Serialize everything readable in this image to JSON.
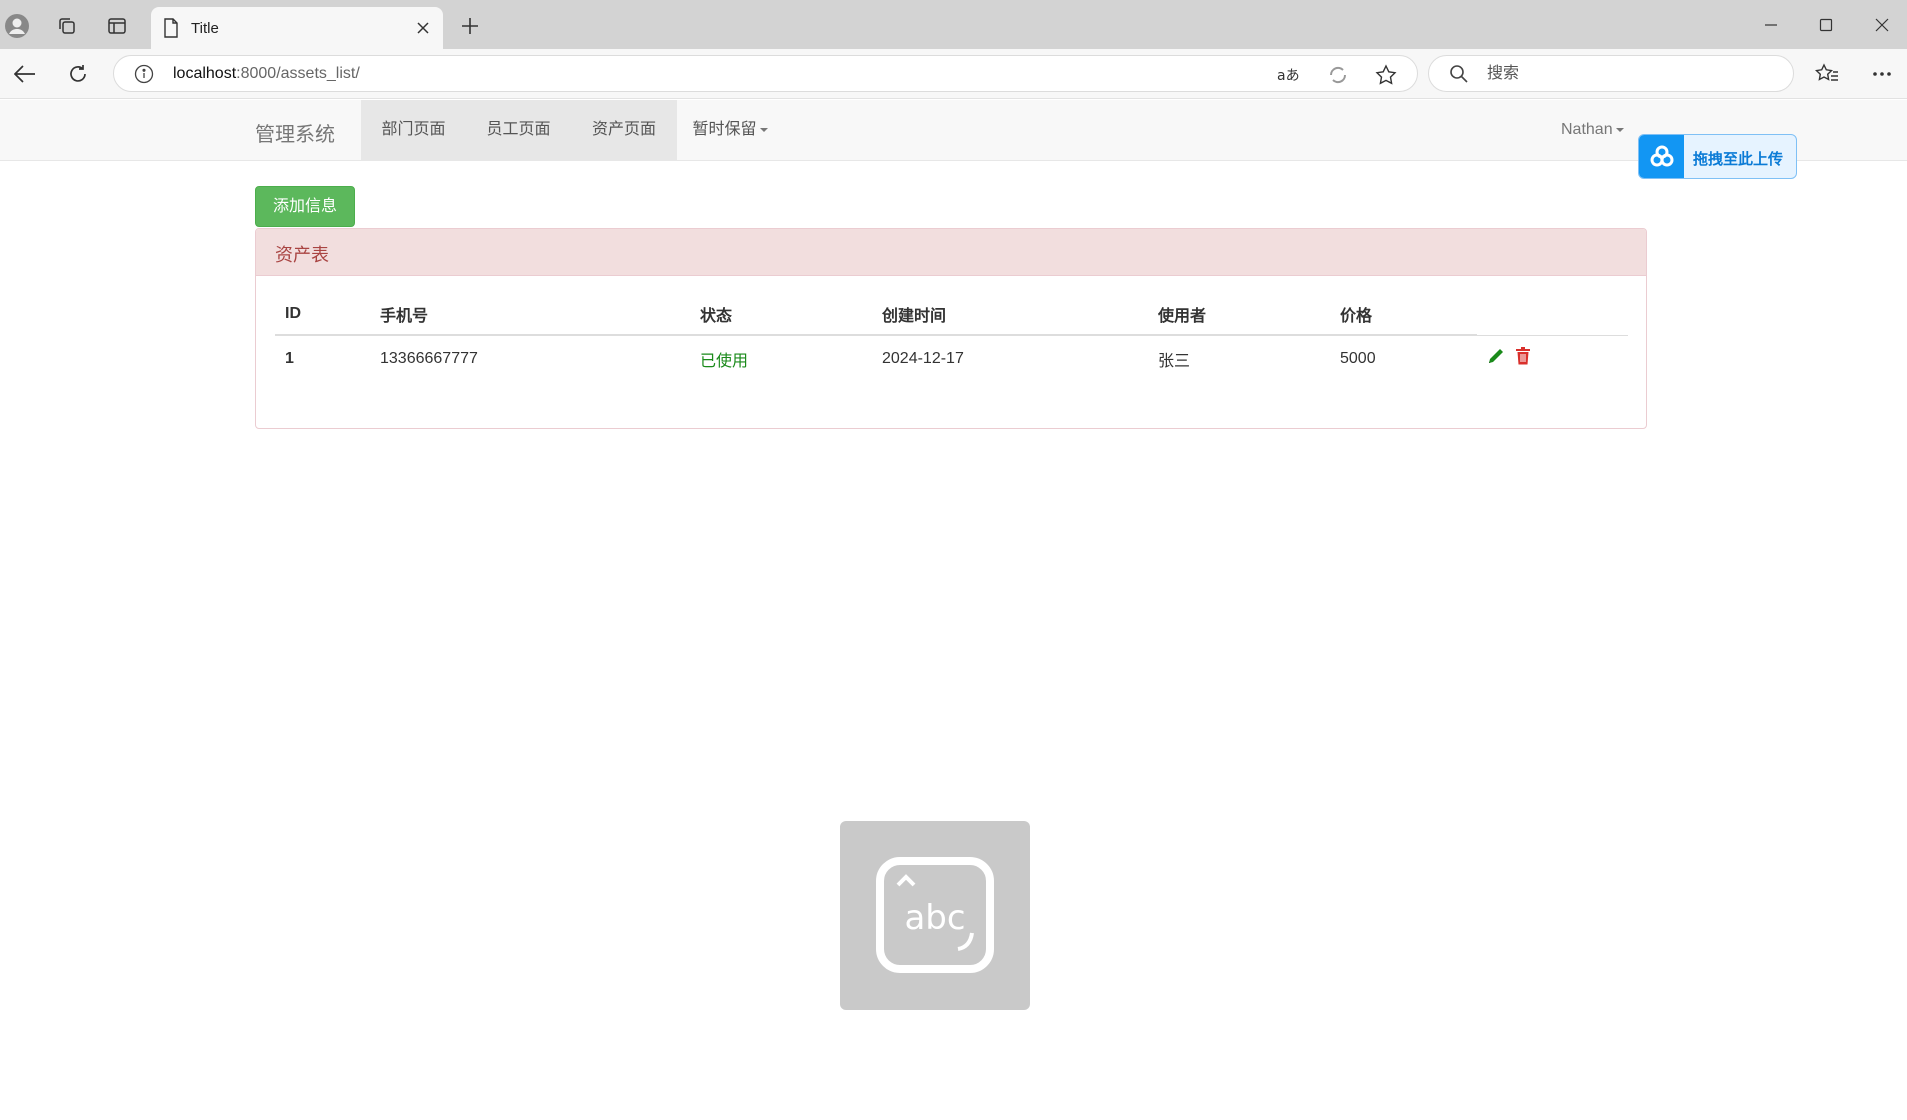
{
  "browser": {
    "tab_title": "Title",
    "url_host": "localhost",
    "url_path": ":8000/assets_list/",
    "search_placeholder": "搜索"
  },
  "navbar": {
    "brand": "管理系统",
    "items": [
      {
        "label": "部门页面"
      },
      {
        "label": "员工页面"
      },
      {
        "label": "资产页面"
      },
      {
        "label": "暂时保留"
      }
    ],
    "user": "Nathan"
  },
  "upload_widget": {
    "label": "拖拽至此上传"
  },
  "add_button": "添加信息",
  "panel": {
    "title": "资产表",
    "columns": [
      "ID",
      "手机号",
      "状态",
      "创建时间",
      "使用者",
      "价格"
    ],
    "rows": [
      {
        "id": "1",
        "phone": "13366667777",
        "status": "已使用",
        "created": "2024-12-17",
        "user": "张三",
        "price": "5000"
      }
    ]
  },
  "colors": {
    "status_green": "#1a8a1a",
    "edit_icon": "#1a8a1a",
    "delete_icon": "#d9302c",
    "panel_heading_bg": "#f2dede",
    "button_green": "#5cb85c"
  }
}
